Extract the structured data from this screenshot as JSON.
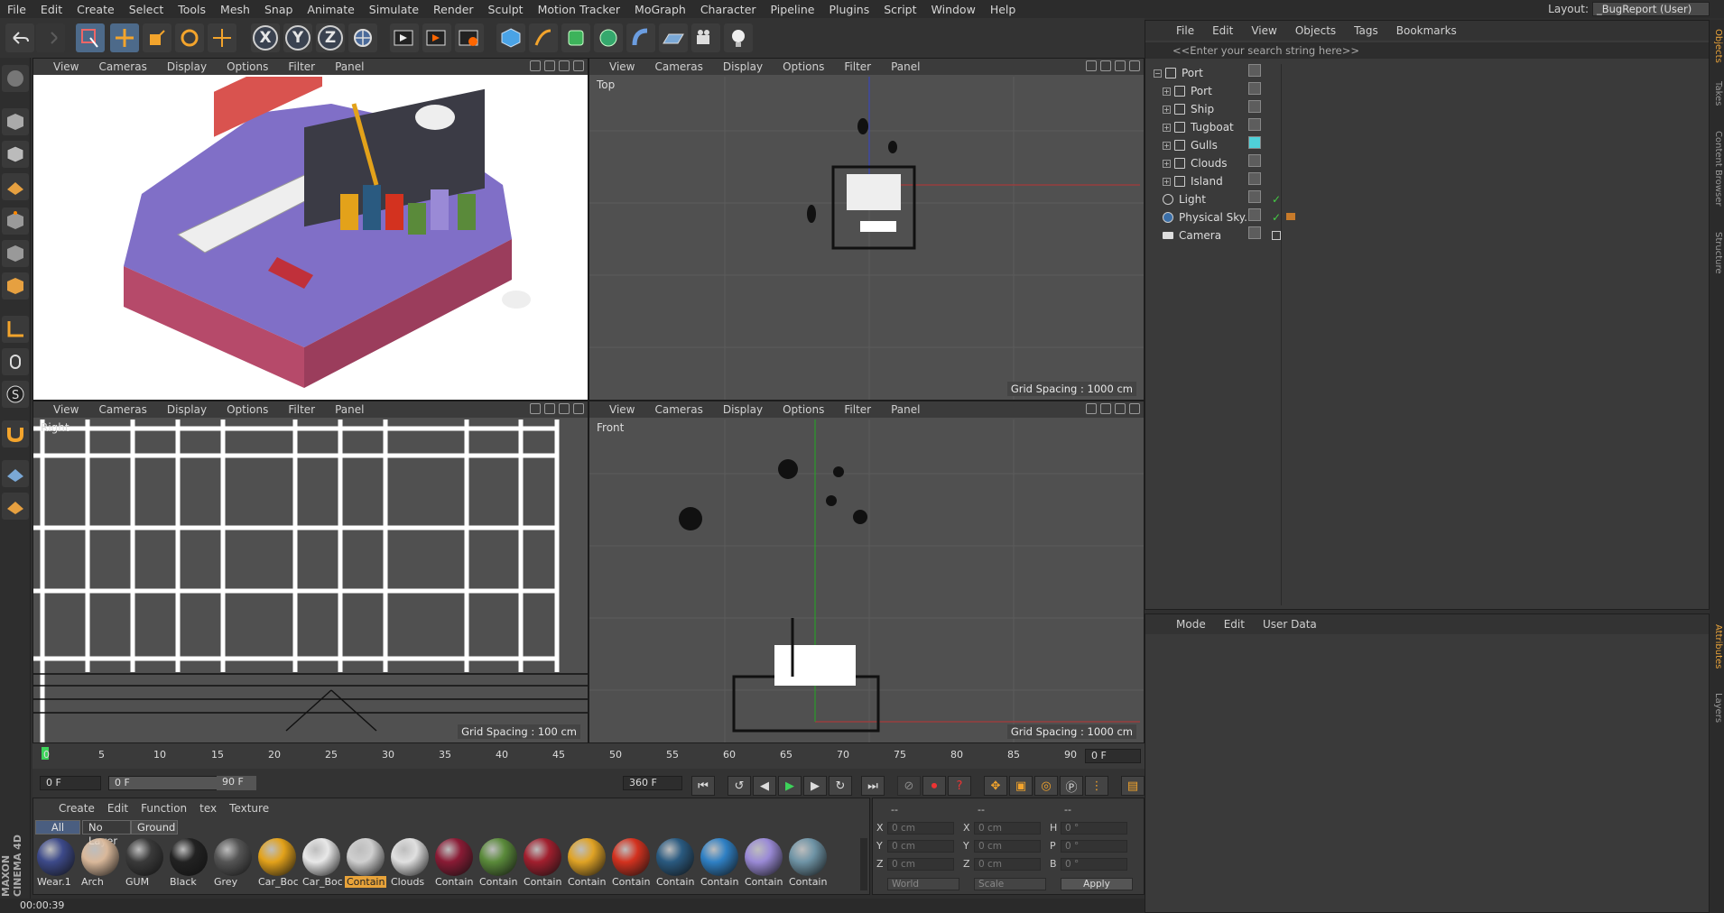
{
  "menubar": {
    "items": [
      "File",
      "Edit",
      "Create",
      "Select",
      "Tools",
      "Mesh",
      "Snap",
      "Animate",
      "Simulate",
      "Render",
      "Sculpt",
      "Motion Tracker",
      "MoGraph",
      "Character",
      "Pipeline",
      "Plugins",
      "Script",
      "Window",
      "Help"
    ]
  },
  "layout": {
    "label": "Layout:",
    "value": "_BugReport (User)"
  },
  "toolbar": {
    "axes": [
      "X",
      "Y",
      "Z"
    ]
  },
  "viewport_menu": [
    "View",
    "Cameras",
    "Display",
    "Options",
    "Filter",
    "Panel"
  ],
  "viewports": {
    "persp": {
      "name": ""
    },
    "top": {
      "name": "Top",
      "grid": "Grid Spacing : 1000 cm"
    },
    "right": {
      "name": "Right",
      "grid": "Grid Spacing : 100 cm"
    },
    "front": {
      "name": "Front",
      "grid": "Grid Spacing : 1000 cm"
    }
  },
  "objects": {
    "menu": [
      "File",
      "Edit",
      "View",
      "Objects",
      "Tags",
      "Bookmarks"
    ],
    "search_placeholder": "<<Enter your search string here>>",
    "items": [
      {
        "name": "Port",
        "level": 0
      },
      {
        "name": "Port",
        "level": 1
      },
      {
        "name": "Ship",
        "level": 1
      },
      {
        "name": "Tugboat",
        "level": 1
      },
      {
        "name": "Gulls",
        "level": 1
      },
      {
        "name": "Clouds",
        "level": 1
      },
      {
        "name": "Island",
        "level": 1
      },
      {
        "name": "Light",
        "level": 0
      },
      {
        "name": "Physical Sky.1",
        "level": 0
      },
      {
        "name": "Camera",
        "level": 0
      }
    ]
  },
  "attributes": {
    "menu": [
      "Mode",
      "Edit",
      "User Data"
    ]
  },
  "right_tabs": [
    "Objects",
    "Takes",
    "Content Browser",
    "Structure",
    "Attributes",
    "Layers"
  ],
  "timeline": {
    "ticks": [
      "0",
      "5",
      "10",
      "15",
      "20",
      "25",
      "30",
      "35",
      "40",
      "45",
      "50",
      "55",
      "60",
      "65",
      "70",
      "75",
      "80",
      "85",
      "90"
    ],
    "current": "0 F",
    "start": "0 F",
    "range_start": "0 F",
    "range_end": "90 F",
    "end": "360 F"
  },
  "materials": {
    "menu": [
      "Create",
      "Edit",
      "Function",
      "tex",
      "Texture"
    ],
    "tabs": [
      "All",
      "No Layer",
      "Ground"
    ],
    "items": [
      {
        "label": "Wear.1",
        "color": "#3d4a8a"
      },
      {
        "label": "Arch",
        "color": "#d9b89a"
      },
      {
        "label": "GUM",
        "color": "#3a3a3a"
      },
      {
        "label": "Black",
        "color": "#222222"
      },
      {
        "label": "Grey",
        "color": "#555555"
      },
      {
        "label": "Car_Boc",
        "color": "#e3a21a"
      },
      {
        "label": "Car_Boc",
        "color": "#e8e8e8"
      },
      {
        "label": "Contain",
        "color": "#cfcfcf"
      },
      {
        "label": "Clouds",
        "color": "#e0e0e0"
      },
      {
        "label": "Contain",
        "color": "#8a1b35"
      },
      {
        "label": "Contain",
        "color": "#5a8a3a"
      },
      {
        "label": "Contain",
        "color": "#a11f2e"
      },
      {
        "label": "Contain",
        "color": "#e0a325"
      },
      {
        "label": "Contain",
        "color": "#d3321f"
      },
      {
        "label": "Contain",
        "color": "#2a5a80"
      },
      {
        "label": "Contain",
        "color": "#2f80c4"
      },
      {
        "label": "Contain",
        "color": "#9a8ad6"
      },
      {
        "label": "Contain",
        "color": "#6f94a6"
      }
    ]
  },
  "coordinates": {
    "header": [
      "--",
      "--",
      "--"
    ],
    "rows": [
      {
        "a": "X",
        "av": "0 cm",
        "b": "X",
        "bv": "0 cm",
        "c": "H",
        "cv": "0 °"
      },
      {
        "a": "Y",
        "av": "0 cm",
        "b": "Y",
        "bv": "0 cm",
        "c": "P",
        "cv": "0 °"
      },
      {
        "a": "Z",
        "av": "0 cm",
        "b": "Z",
        "bv": "0 cm",
        "c": "B",
        "cv": "0 °"
      }
    ],
    "mode1": "World",
    "mode2": "Scale",
    "apply": "Apply"
  },
  "status": {
    "time": "00:00:39"
  },
  "brand": "MAXON CINEMA 4D"
}
